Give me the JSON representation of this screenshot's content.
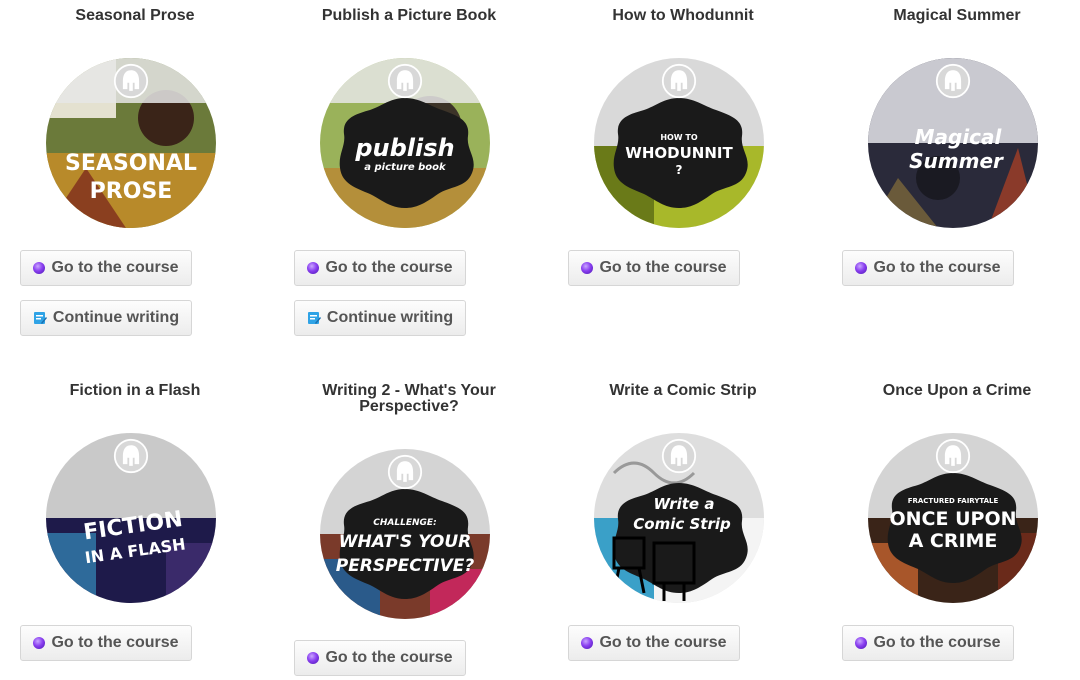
{
  "buttons": {
    "go_label": "Go to the course",
    "continue_label": "Continue writing"
  },
  "icons": {
    "go": "purple-orb-icon",
    "continue": "pencil-note-icon",
    "badge": "helmet-icon"
  },
  "colors": {
    "go_icon": "#8a3ff0",
    "continue_icon": "#2fa3e6"
  },
  "courses": [
    {
      "title": "Seasonal Prose",
      "art_line1": "SEASONAL",
      "art_line2": "PROSE"
    },
    {
      "title": "Publish a Picture Book",
      "art_line1": "publish",
      "art_line2": "a picture book"
    },
    {
      "title": "How to Whodunnit",
      "art_line0": "HOW TO",
      "art_line1": "WHODUNNIT",
      "art_line2": "?"
    },
    {
      "title": "Magical Summer",
      "art_line1": "Magical",
      "art_line2": "Summer"
    },
    {
      "title": "Fiction in a Flash",
      "art_line1": "FICTION",
      "art_line2": "IN A FLASH"
    },
    {
      "title_line1": "Writing 2 - What's Your",
      "title_line2": "Perspective?",
      "art_line0": "CHALLENGE:",
      "art_line1": "WHAT'S YOUR",
      "art_line2": "PERSPECTIVE?"
    },
    {
      "title": "Write a Comic Strip",
      "art_line1": "Write a",
      "art_line2": "Comic Strip"
    },
    {
      "title": "Once Upon a Crime",
      "art_line0": "FRACTURED FAIRYTALE",
      "art_line1": "ONCE UPON",
      "art_line2": "A CRIME"
    }
  ]
}
